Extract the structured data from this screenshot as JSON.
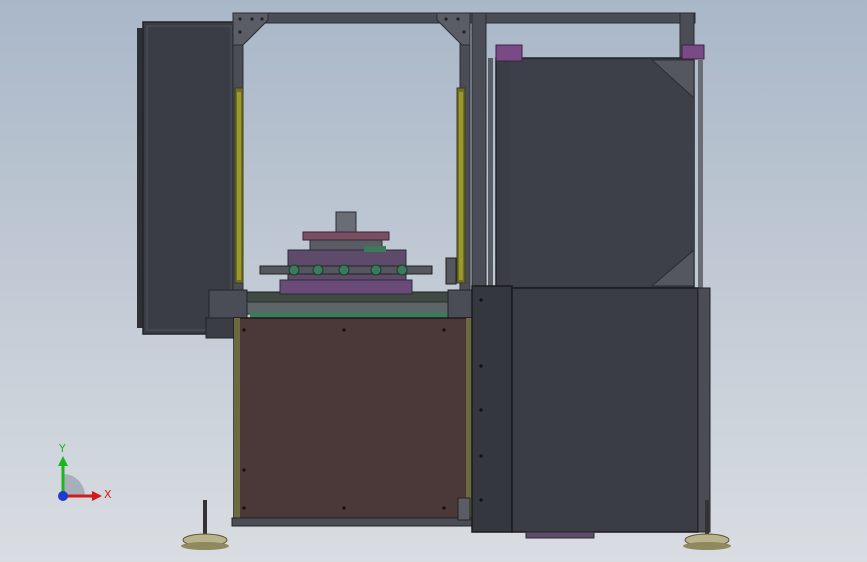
{
  "colors": {
    "background_top": "#a9b7c8",
    "background_bottom": "#d9dde2",
    "frame": "#4a4d55",
    "frame_edge": "#2b2d33",
    "panel_dark": "#3a3d44",
    "panel_darker": "#34373d",
    "cabinet_front": "#4b3838",
    "accent_purple": "#7a4a86",
    "accent_yellow": "#9a9a2a",
    "accent_green": "#3c7a5c",
    "pedestal": "#b8b38a",
    "axis_x": "#d21c1c",
    "axis_y": "#1fb51f",
    "axis_z": "#1c3cd2"
  },
  "triad": {
    "x_label": "X",
    "y_label": "Y",
    "icon": "coordinate-triad-icon"
  }
}
